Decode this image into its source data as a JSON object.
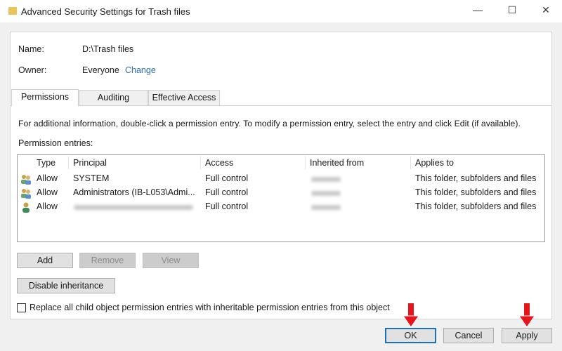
{
  "window": {
    "title": "Advanced Security Settings for Trash files",
    "icon": "folder-icon"
  },
  "info": {
    "name_label": "Name:",
    "name_value": "D:\\Trash files",
    "owner_label": "Owner:",
    "owner_value": "Everyone",
    "change_link": "Change"
  },
  "tabs": [
    {
      "label": "Permissions",
      "active": true
    },
    {
      "label": "Auditing"
    },
    {
      "label": "Effective Access"
    }
  ],
  "description": "For additional information, double-click a permission entry. To modify a permission entry, select the entry and click Edit (if available).",
  "entries_label": "Permission entries:",
  "columns": [
    "Type",
    "Principal",
    "Access",
    "Inherited from",
    "Applies to"
  ],
  "rows": [
    {
      "icon": "group-users-icon",
      "type": "Allow",
      "principal": "SYSTEM",
      "access": "Full control",
      "applies": "This folder, subfolders and files"
    },
    {
      "icon": "group-users-icon",
      "type": "Allow",
      "principal": "Administrators (IB-L053\\Admi...",
      "access": "Full control",
      "applies": "This folder, subfolders and files"
    },
    {
      "icon": "user-icon",
      "type": "Allow",
      "principal": "",
      "access": "Full control",
      "applies": "This folder, subfolders and files"
    }
  ],
  "buttons": {
    "add": "Add",
    "remove": "Remove",
    "view": "View",
    "disable_inheritance": "Disable inheritance",
    "ok": "OK",
    "cancel": "Cancel",
    "apply": "Apply"
  },
  "replace_checkbox": {
    "label": "Replace all child object permission entries with inheritable permission entries from this object",
    "checked": false
  },
  "colors": {
    "link": "#2a6fb0",
    "focus_border": "#1f6fb5",
    "annotation_arrow": "#e8141c"
  }
}
